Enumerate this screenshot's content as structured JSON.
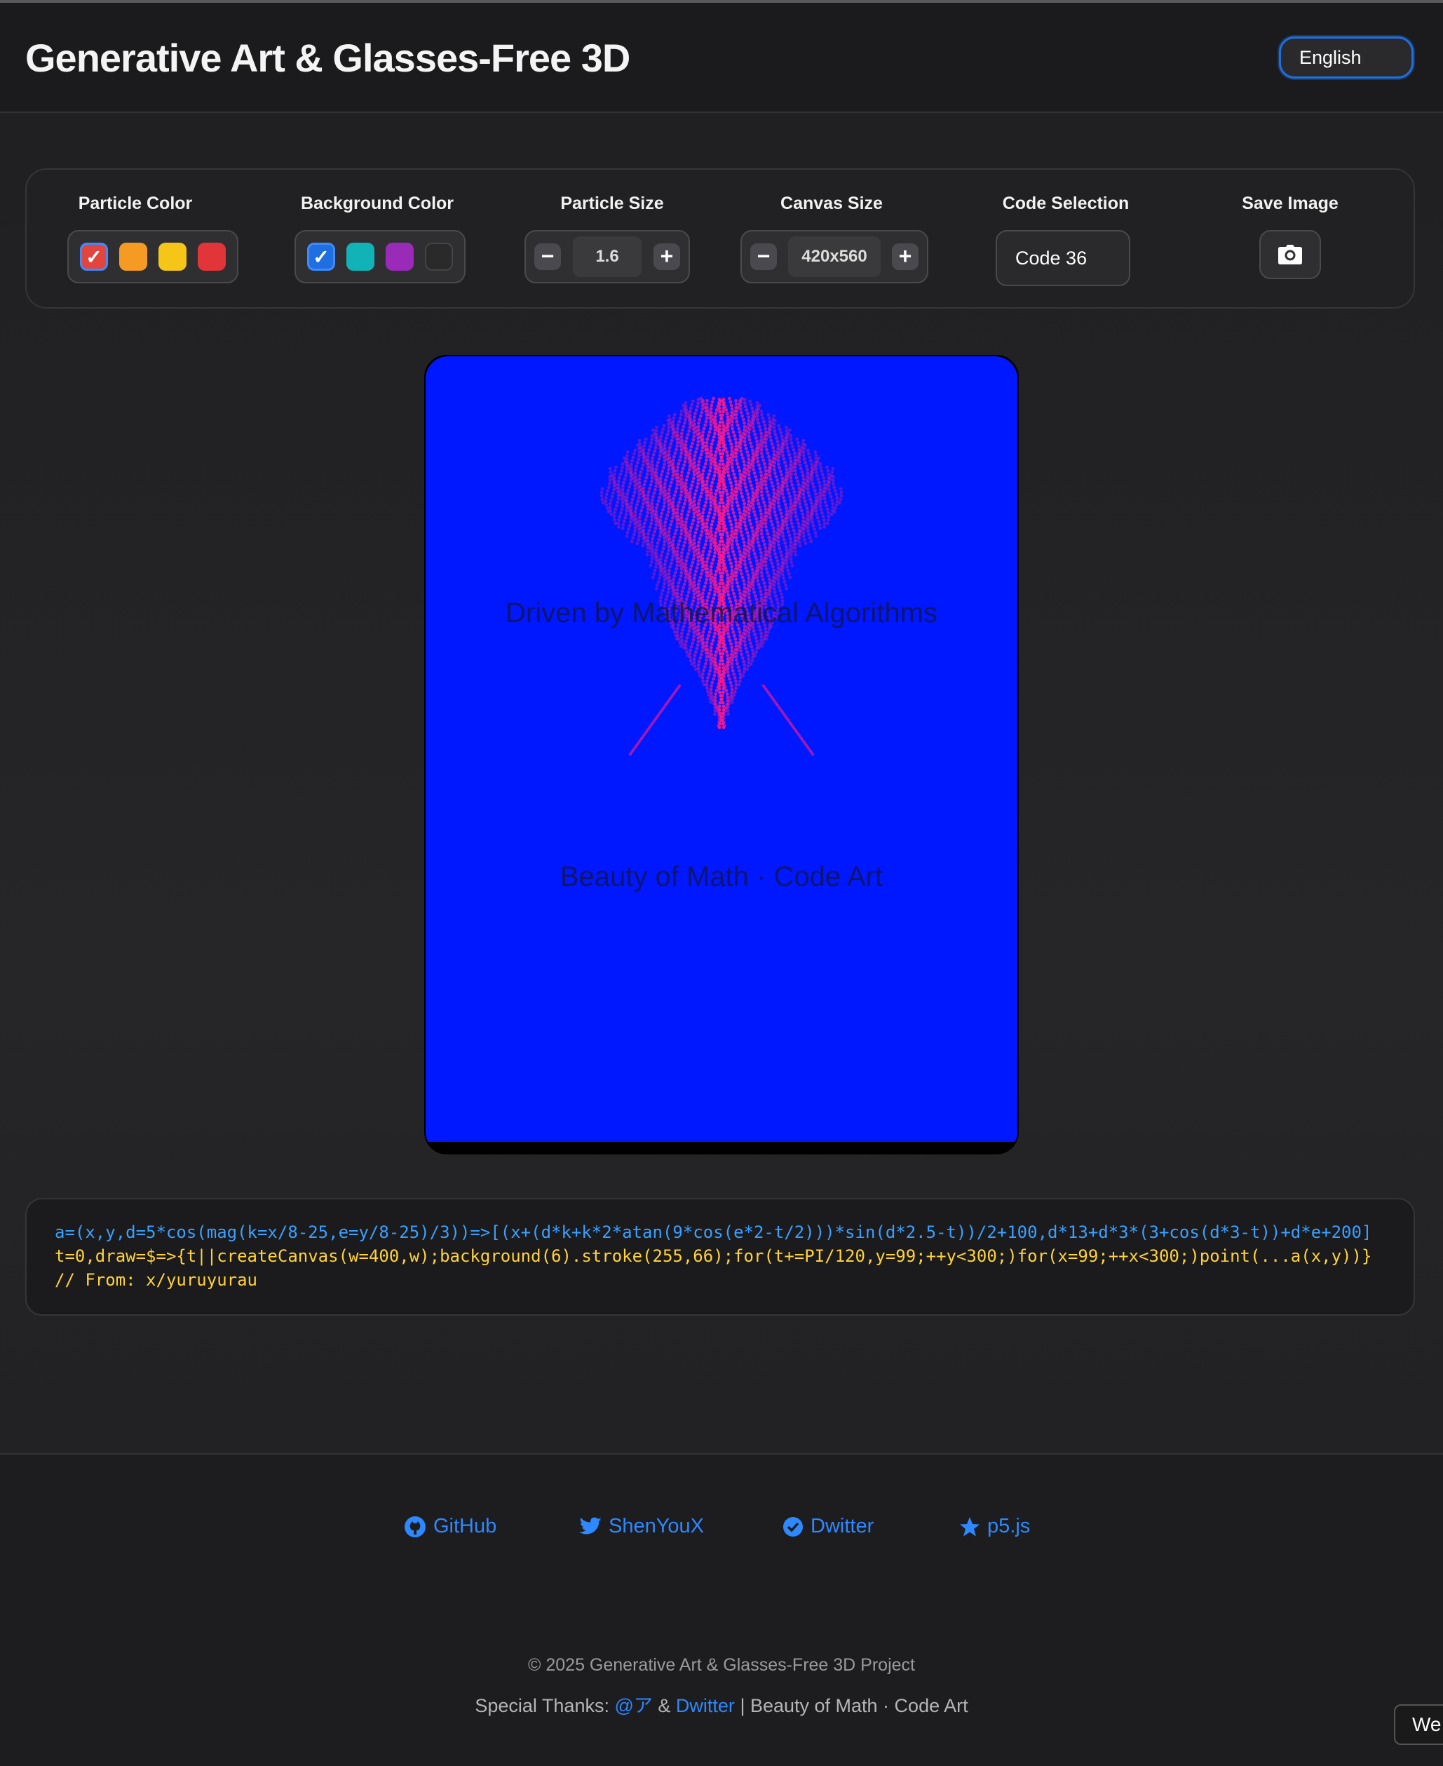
{
  "header": {
    "title": "Generative Art & Glasses-Free 3D",
    "language": "English"
  },
  "controls": {
    "particle_color": {
      "label": "Particle Color",
      "options": [
        "#e2453d",
        "#f59a23",
        "#f5c518",
        "#e2353a"
      ],
      "selected": "#e2453d"
    },
    "background_color": {
      "label": "Background Color",
      "options": [
        "#1f6fe0",
        "#12b3b8",
        "#9a2ab8",
        "#2a2a2a"
      ],
      "selected": "#1f6fe0"
    },
    "particle_size": {
      "label": "Particle Size",
      "value": "1.6",
      "minus": "−",
      "plus": "+"
    },
    "canvas_size": {
      "label": "Canvas Size",
      "value": "420x560",
      "minus": "−",
      "plus": "+"
    },
    "code_selection": {
      "label": "Code Selection",
      "value": "Code 36"
    },
    "save_image": {
      "label": "Save Image",
      "icon": "camera-icon"
    }
  },
  "canvas": {
    "background": "#0018ff",
    "particle_color": "#ff1a8c",
    "overlay_top": "Driven by Mathematical Algorithms",
    "overlay_bottom": "Beauty of Math · Code Art"
  },
  "code": {
    "line1": "a=(x,y,d=5*cos(mag(k=x/8-25,e=y/8-25)/3))=>[(x+(d*k+k*2*atan(9*cos(e*2-t/2)))*sin(d*2.5-t))/2+100,d*13+d*3*(3+cos(d*3-t))+d*e+200]",
    "line2": "t=0,draw=$=>{t||createCanvas(w=400,w);background(6).stroke(255,66);for(t+=PI/120,y=99;++y<300;)for(x=99;++x<300;)point(...a(x,y))}",
    "line3": "// From: x/yuruyurau"
  },
  "footer": {
    "links": [
      {
        "label": "GitHub",
        "icon": "github-icon"
      },
      {
        "label": "ShenYouX",
        "icon": "twitter-icon"
      },
      {
        "label": "Dwitter",
        "icon": "verified-icon"
      },
      {
        "label": "p5.js",
        "icon": "star-icon"
      }
    ],
    "copyright": "© 2025 Generative Art & Glasses-Free 3D Project",
    "thanks_prefix": "Special Thanks: ",
    "thanks_user": "@ア",
    "thanks_amp": " & ",
    "thanks_dwitter": "Dwitter",
    "thanks_suffix": " | Beauty of Math · Code Art"
  },
  "corner_button": "We"
}
